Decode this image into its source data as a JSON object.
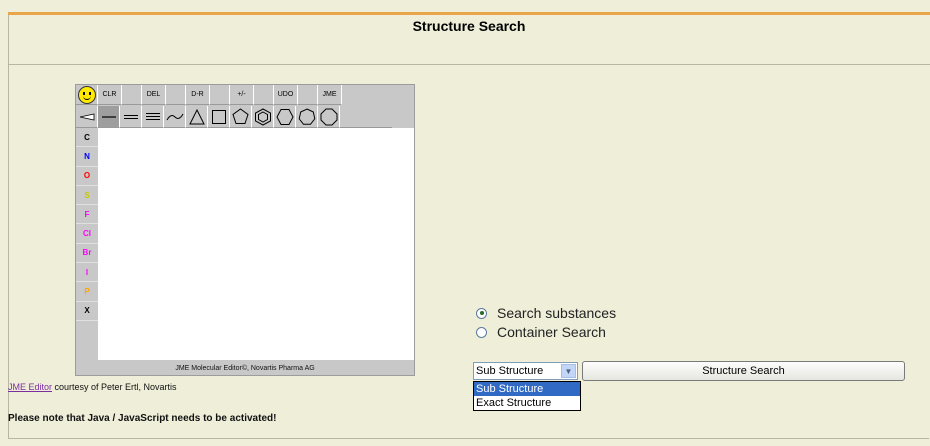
{
  "page": {
    "title": "Structure Search"
  },
  "jme": {
    "toolbar_top": [
      "CLR",
      "DEL",
      "D-R",
      "+/-",
      "UDO",
      "JME"
    ],
    "atoms": [
      "C",
      "N",
      "O",
      "S",
      "F",
      "Cl",
      "Br",
      "I",
      "P",
      "X"
    ],
    "atom_colors": [
      "#000000",
      "#0000ff",
      "#ff0000",
      "#c8c800",
      "#ff00ff",
      "#ff00ff",
      "#ff00ff",
      "#ff00ff",
      "#ffa500",
      "#000000"
    ],
    "footer": "JME Molecular Editor©, Novartis Pharma AG",
    "icons": [
      "smiley-icon",
      "stereo-bond-icon",
      "single-bond-icon",
      "double-bond-icon",
      "triple-bond-icon",
      "chain-icon",
      "ring3-icon",
      "ring4-icon",
      "ring5-icon",
      "benzene-icon",
      "ring6-icon",
      "ring7-icon",
      "ring8-icon"
    ]
  },
  "credit": {
    "link": "JME Editor",
    "text": " courtesy of Peter Ertl, Novartis"
  },
  "note": "Please note that Java / JavaScript needs to be activated!",
  "search": {
    "radio1": "Search substances",
    "radio2": "Container Search",
    "select_value": "Sub Structure",
    "options": [
      "Sub Structure",
      "Exact Structure"
    ],
    "button": "Structure Search"
  }
}
